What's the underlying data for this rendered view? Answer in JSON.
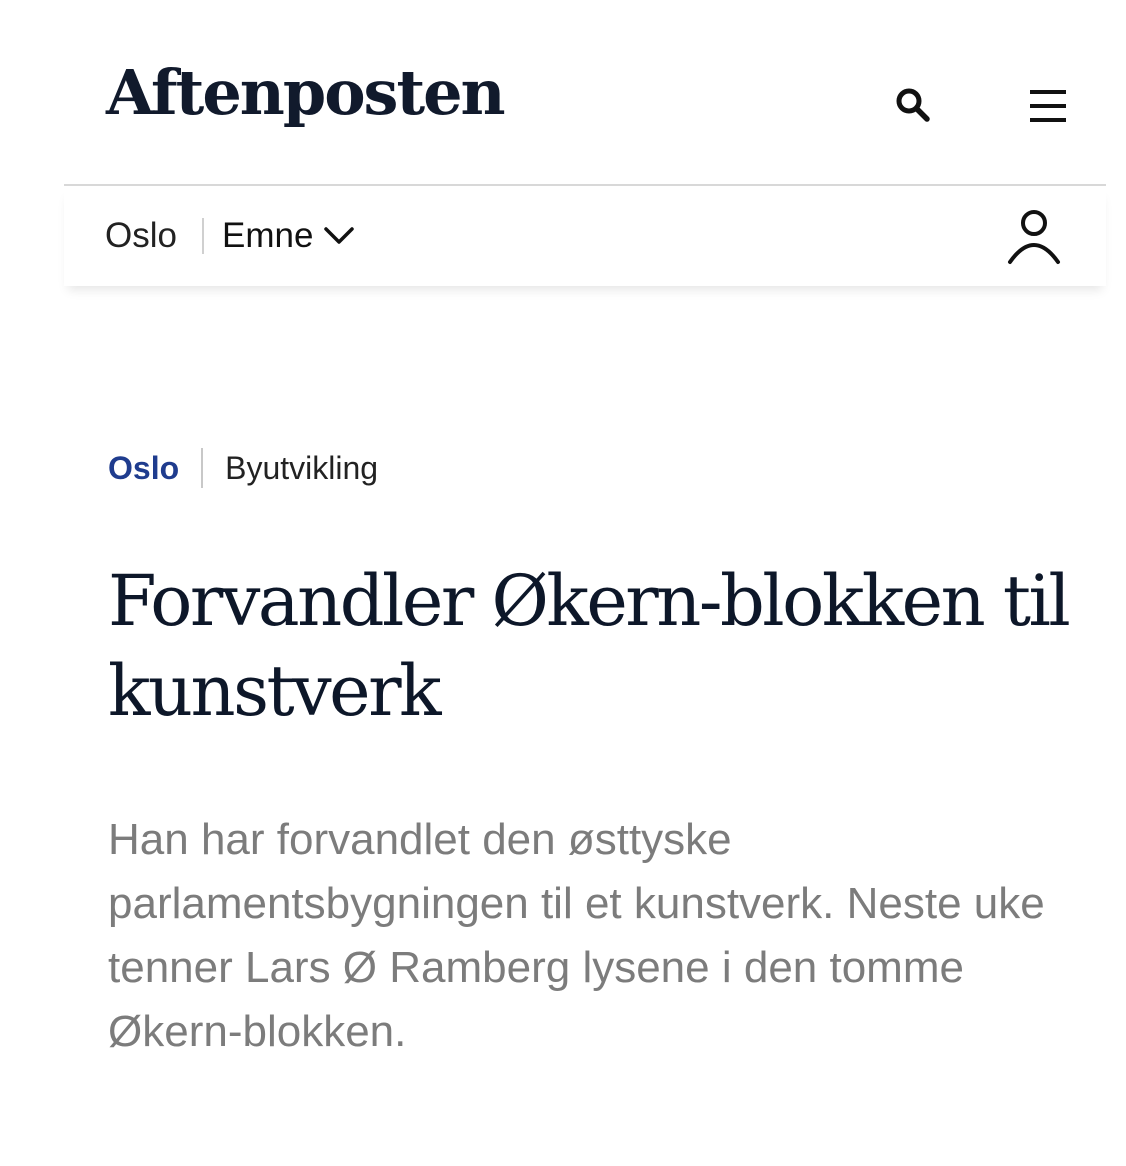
{
  "header": {
    "logo_text": "Aftenposten",
    "icons": {
      "search": "search-icon",
      "menu": "hamburger-menu-icon",
      "user": "user-icon",
      "dropdown": "chevron-down-icon"
    }
  },
  "subnav": {
    "section_label": "Oslo",
    "topics_label": "Emne"
  },
  "article": {
    "breadcrumb": {
      "section": "Oslo",
      "topic": "Byutvikling"
    },
    "headline": "Forvandler Økern-blokken til kunstverk",
    "lede": "Han har forvandlet den østtyske parlamentsbygningen til et kunstverk. Neste uke tenner Lars Ø Ramberg lysene i den tomme Økern-blokken."
  },
  "colors": {
    "section_accent": "#1f3c8e",
    "headline": "#0d1729",
    "lede": "#7c7c7c",
    "divider": "#d8d8d8"
  }
}
